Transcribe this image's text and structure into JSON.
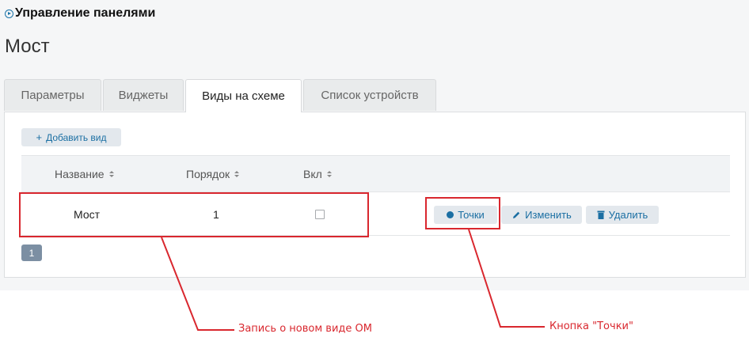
{
  "header": {
    "title": "Управление панелями"
  },
  "page": {
    "title": "Мост"
  },
  "tabs": [
    {
      "label": "Параметры",
      "active": false
    },
    {
      "label": "Виджеты",
      "active": false
    },
    {
      "label": "Виды на схеме",
      "active": true
    },
    {
      "label": "Список устройств",
      "active": false
    }
  ],
  "toolbar": {
    "add_label": "Добавить вид",
    "add_icon": "plus-icon"
  },
  "table": {
    "columns": [
      "Название",
      "Порядок",
      "Вкл"
    ],
    "rows": [
      {
        "name": "Мост",
        "order": "1",
        "enabled": false
      }
    ],
    "actions": {
      "points_label": "Точки",
      "edit_label": "Изменить",
      "delete_label": "Удалить"
    }
  },
  "pagination": {
    "current_page": "1"
  },
  "annotations": {
    "record_label": "Запись о новом виде ОМ",
    "points_button_label": "Кнопка \"Точки\""
  },
  "colors": {
    "accent": "#1b6fa3",
    "annotation": "#d9272e",
    "page_button": "#7c8fa3"
  }
}
